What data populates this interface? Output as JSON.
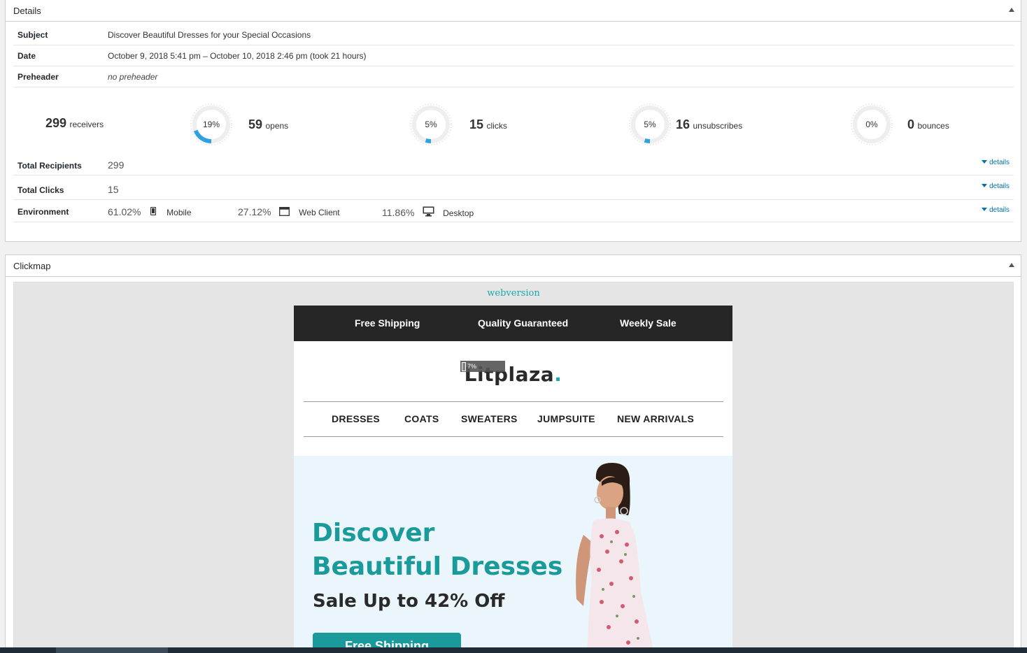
{
  "details": {
    "title": "Details",
    "subject_label": "Subject",
    "subject_value": "Discover Beautiful Dresses for your Special Occasions",
    "date_label": "Date",
    "date_value": "October 9, 2018 5:41 pm – October 10, 2018 2:46 pm (took 21 hours)",
    "preheader_label": "Preheader",
    "preheader_value": "no preheader",
    "stats": {
      "receivers": {
        "num": "299",
        "unit": "receivers"
      },
      "opens": {
        "num": "59",
        "unit": "opens",
        "pct": "19%",
        "rate": 0.19
      },
      "clicks": {
        "num": "15",
        "unit": "clicks",
        "pct": "5%",
        "rate": 0.05
      },
      "unsubscribes": {
        "num": "16",
        "unit": "unsubscribes",
        "pct": "5%",
        "rate": 0.05
      },
      "bounces": {
        "num": "0",
        "unit": "bounces",
        "pct": "0%",
        "rate": 0
      }
    },
    "total_recipients_label": "Total Recipients",
    "total_recipients_value": "299",
    "total_clicks_label": "Total Clicks",
    "total_clicks_value": "15",
    "environment_label": "Environment",
    "environment": [
      {
        "pct": "61.02%",
        "label": "Mobile",
        "icon": "mobile-icon"
      },
      {
        "pct": "27.12%",
        "label": "Web Client",
        "icon": "browser-window-icon"
      },
      {
        "pct": "11.86%",
        "label": "Desktop",
        "icon": "desktop-monitor-icon"
      }
    ],
    "details_link": "details"
  },
  "clickmap": {
    "title": "Clickmap",
    "webversion": "webversion",
    "topbar": [
      "Free Shipping",
      "Quality Guaranteed",
      "Weekly Sale"
    ],
    "logo_text": "Litplaza",
    "logo_dot": ".",
    "click_badge": "7%",
    "nav": [
      "DRESSES",
      "COATS",
      "SWEATERS",
      "JUMPSUITE",
      "NEW ARRIVALS"
    ],
    "hero_title": "Discover Beautiful Dresses",
    "hero_sub": "Sale Up to 42% Off",
    "hero_button": "Free Shipping"
  },
  "colors": {
    "accent": "#1aa8a8",
    "donut_fill": "#2ea2e0",
    "donut_track": "#eeeeee",
    "link": "#0073aa"
  }
}
